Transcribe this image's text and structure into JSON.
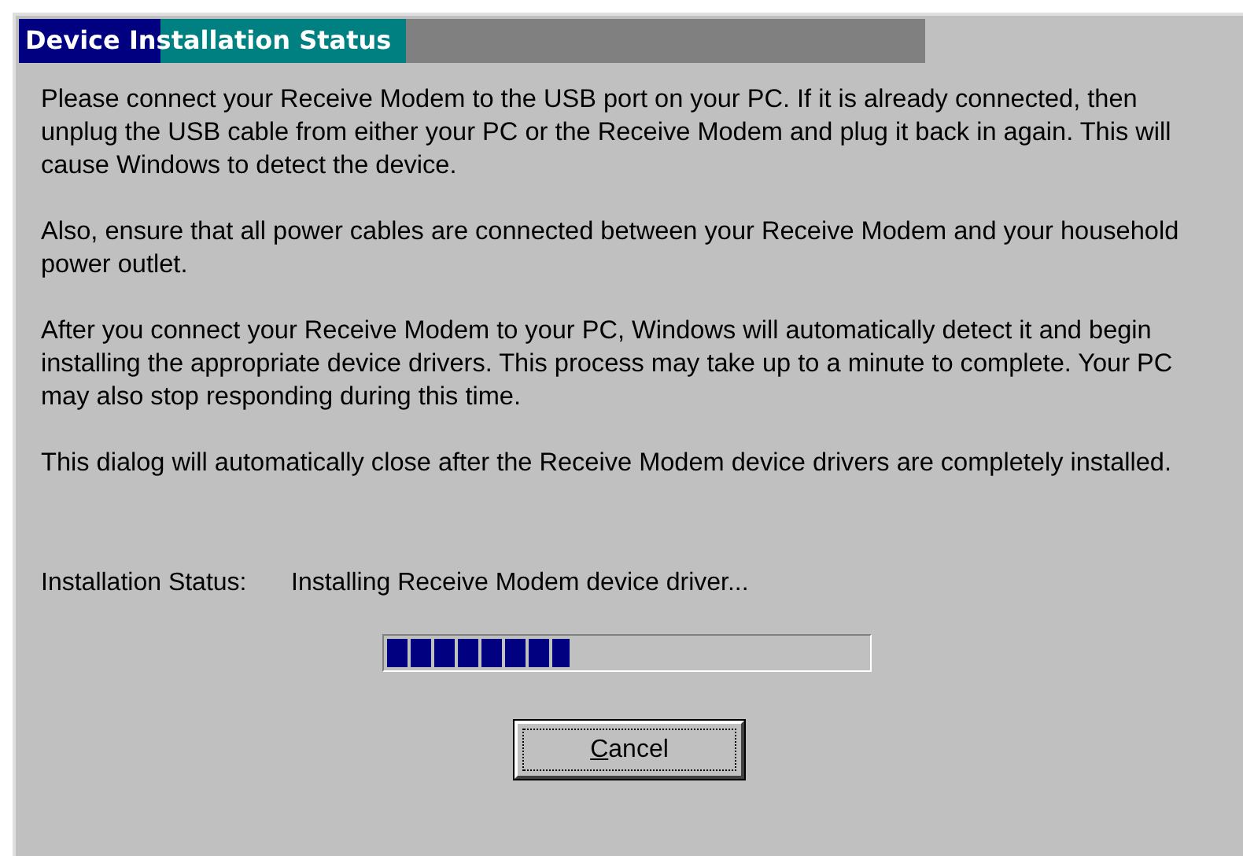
{
  "window": {
    "title": "Device Installation Status"
  },
  "paragraphs": [
    "Please connect your Receive Modem to the USB port on your PC. If it is already connected, then unplug the USB cable from either your PC or the Receive Modem and plug it back in again. This will cause Windows to detect the device.",
    "Also, ensure that all power cables are connected between your Receive Modem and your household power outlet.",
    "After you connect your Receive Modem to your PC, Windows will automatically detect it and begin installing the appropriate device drivers. This process may take up to a minute to complete. Your PC may also stop responding during this time.",
    "This dialog will automatically close after the Receive Modem device drivers are completely installed."
  ],
  "status": {
    "label": "Installation Status:",
    "value": "Installing Receive Modem device driver..."
  },
  "progress": {
    "level": 0.38
  },
  "button": {
    "label": "Cancel",
    "focused": true
  }
}
